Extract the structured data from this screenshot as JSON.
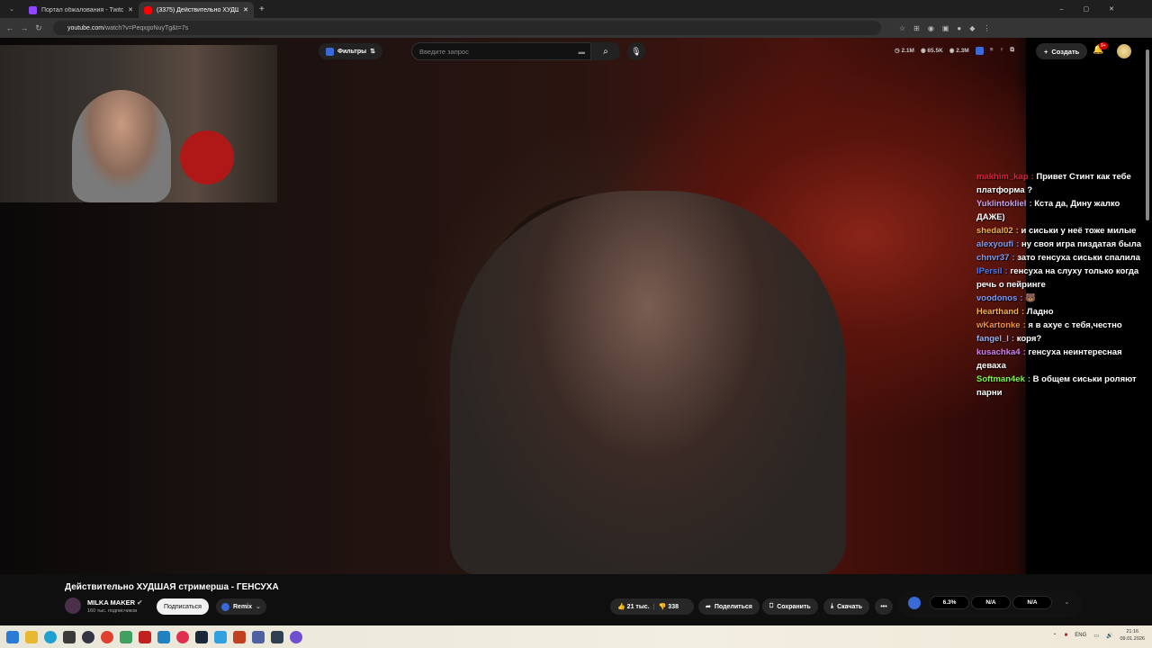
{
  "browser": {
    "tabs": [
      {
        "title": "Портал обжалования - Twitch",
        "active": false
      },
      {
        "title": "(3375) Действительно ХУДШАЯ стримерша - ГЕНСУХА",
        "active": true
      }
    ],
    "url_host": "youtube.com",
    "url_path": "/watch?v=PeqxgoNuyTg&t=7s"
  },
  "header": {
    "filters": "Фильтры",
    "search_placeholder": "Введите запрос",
    "stats": [
      "2.1M",
      "65.5K",
      "2.3M"
    ],
    "create": "Создать",
    "notifications": "9+"
  },
  "chat": [
    {
      "user": "makhim_kap",
      "color": "#e0203a",
      "text": "Привет Стинт как тебе платформа ?"
    },
    {
      "user": "Yuklintokliel",
      "color": "#c8a0f0",
      "text": "Кста да, Дину жалко ДАЖЕ)"
    },
    {
      "user": "shedal02",
      "color": "#f0b050",
      "text": "и сиськи у неё тоже милые"
    },
    {
      "user": "alexyoufi",
      "color": "#7a9af0",
      "text": "ну своя игра пиздатая была"
    },
    {
      "user": "chnvr37",
      "color": "#7a9af0",
      "text": "зато генсуха сиськи спалила"
    },
    {
      "user": "lPersil",
      "color": "#4a7af0",
      "text": "генсуха на слуху только когда речь о пейринге"
    },
    {
      "user": "voodonos",
      "color": "#7a9af0",
      "text": "🐻"
    },
    {
      "user": "Hearthand",
      "color": "#f0b050",
      "text": "Ладно"
    },
    {
      "user": "wKartonke",
      "color": "#f09040",
      "text": "я в ахуе с тебя,честно"
    },
    {
      "user": "fangel_l",
      "color": "#9ab0f0",
      "text": "коря?"
    },
    {
      "user": "kusachka4",
      "color": "#d080f0",
      "text": "генсуха неинтересная деваха"
    },
    {
      "user": "Softman4ek",
      "color": "#80f050",
      "text": "В общем сиськи роляют парни"
    }
  ],
  "video": {
    "title": "Действительно ХУДШАЯ стримерша - ГЕНСУХА",
    "channel": "MILKA MAKER",
    "subscribers": "160 тыс. подписчиков",
    "subscribe": "Подписаться",
    "remix": "Remix",
    "likes": "21 тыс.",
    "dislikes": "338",
    "share": "Поделиться",
    "save": "Сохранить",
    "download": "Скачать",
    "ext_values": [
      "6.3%",
      "N/A",
      "N/A"
    ]
  },
  "taskbar": {
    "lang": "ENG",
    "time": "21:16",
    "date": "09.01.2026"
  }
}
